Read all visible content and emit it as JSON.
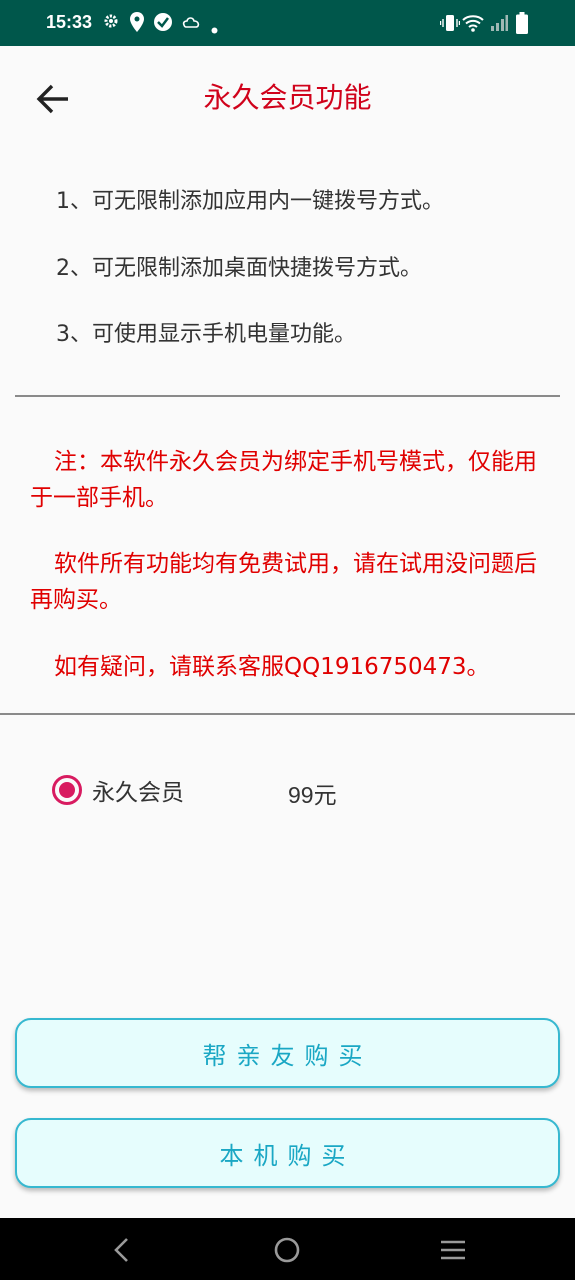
{
  "status_bar": {
    "time": "15:33",
    "left_icons": [
      "gear-icon",
      "location-icon",
      "check-circle-icon",
      "cloud-sync-icon",
      "dot-icon"
    ],
    "right_icons": [
      "vibrate-icon",
      "wifi-icon",
      "signal-icon",
      "battery-icon"
    ],
    "background": "#00574b"
  },
  "header": {
    "title": "永久会员功能",
    "title_color": "#d0021b"
  },
  "features": [
    "1、可无限制添加应用内一键拨号方式。",
    "2、可无限制添加桌面快捷拨号方式。",
    "3、可使用显示手机电量功能。"
  ],
  "notes": [
    "注：本软件永久会员为绑定手机号模式，仅能用于一部手机。",
    "软件所有功能均有免费试用，请在试用没问题后再购买。",
    "如有疑问，请联系客服QQ1916750473。"
  ],
  "plan": {
    "label": "永久会员",
    "price": "99元",
    "selected": true,
    "accent": "#d81b60"
  },
  "buttons": {
    "gift_label": "帮亲友购买",
    "self_label": "本机购买",
    "text_color": "#1aa7c4",
    "border_color": "#36b8d0"
  },
  "nav": {
    "icons": [
      "back-nav-icon",
      "home-nav-icon",
      "menu-nav-icon"
    ]
  }
}
